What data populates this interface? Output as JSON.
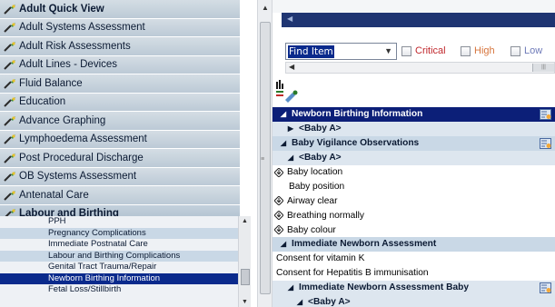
{
  "left_bands": [
    {
      "label": "Adult Quick View",
      "bold": true
    },
    {
      "label": "Adult Systems Assessment",
      "bold": false
    },
    {
      "label": "Adult Risk Assessments",
      "bold": false
    },
    {
      "label": "Adult Lines - Devices",
      "bold": false
    },
    {
      "label": "Fluid Balance",
      "bold": false
    },
    {
      "label": "Education",
      "bold": false
    },
    {
      "label": "Advance Graphing",
      "bold": false
    },
    {
      "label": "Lymphoedema Assessment",
      "bold": false
    },
    {
      "label": "Post Procedural Discharge",
      "bold": false
    },
    {
      "label": "OB Systems Assessment",
      "bold": false
    },
    {
      "label": "Antenatal Care",
      "bold": false
    },
    {
      "label": "Labour and Birthing",
      "bold": true
    }
  ],
  "sub_sections": [
    {
      "label": "PPH"
    },
    {
      "label": "Pregnancy Complications"
    },
    {
      "label": "Immediate Postnatal Care"
    },
    {
      "label": "Labour and Birthing Complications"
    },
    {
      "label": "Genital Tract Trauma/Repair"
    },
    {
      "label": "Newborn Birthing Information",
      "selected": true
    },
    {
      "label": "Fetal Loss/Stillbirth"
    }
  ],
  "toolbar": {
    "find_item": "Find Item",
    "critical": "Critical",
    "high": "High",
    "low": "Low"
  },
  "colors": {
    "critical": "#c0282d",
    "high": "#d6743c",
    "low": "#6e7ab8"
  },
  "grid_rows": [
    {
      "label": "Newborn Birthing Information",
      "style": "hdr-sel",
      "glyph": "triangle-down",
      "indent": 6,
      "insert_icon": true
    },
    {
      "label": "<Baby A>",
      "style": "sub",
      "glyph": "triangle-right",
      "indent": 14
    },
    {
      "label": "Baby Vigilance Observations",
      "style": "hdr",
      "glyph": "triangle-down",
      "indent": 6,
      "insert_icon": true
    },
    {
      "label": "<Baby A>",
      "style": "sub",
      "glyph": "triangle-down",
      "indent": 14
    },
    {
      "label": "Baby location",
      "style": "item",
      "glyph": "diamond",
      "indent": 2
    },
    {
      "label": "Baby position",
      "style": "item",
      "glyph": "none",
      "indent": 18
    },
    {
      "label": "Airway clear",
      "style": "item",
      "glyph": "diamond",
      "indent": 2
    },
    {
      "label": "Breathing normally",
      "style": "item",
      "glyph": "diamond",
      "indent": 2
    },
    {
      "label": "Baby colour",
      "style": "item",
      "glyph": "diamond",
      "indent": 2
    },
    {
      "label": "Immediate Newborn Assessment",
      "style": "hdr",
      "glyph": "triangle-down",
      "indent": 6
    },
    {
      "label": "Consent for vitamin K",
      "style": "item",
      "glyph": "none",
      "indent": 4
    },
    {
      "label": "Consent for Hepatitis B immunisation",
      "style": "item",
      "glyph": "none",
      "indent": 4
    },
    {
      "label": "Immediate Newborn Assessment Baby",
      "style": "sub",
      "glyph": "triangle-down",
      "indent": 14,
      "insert_icon": true
    },
    {
      "label": "<Baby A>",
      "style": "sub",
      "glyph": "triangle-down",
      "indent": 24
    }
  ]
}
